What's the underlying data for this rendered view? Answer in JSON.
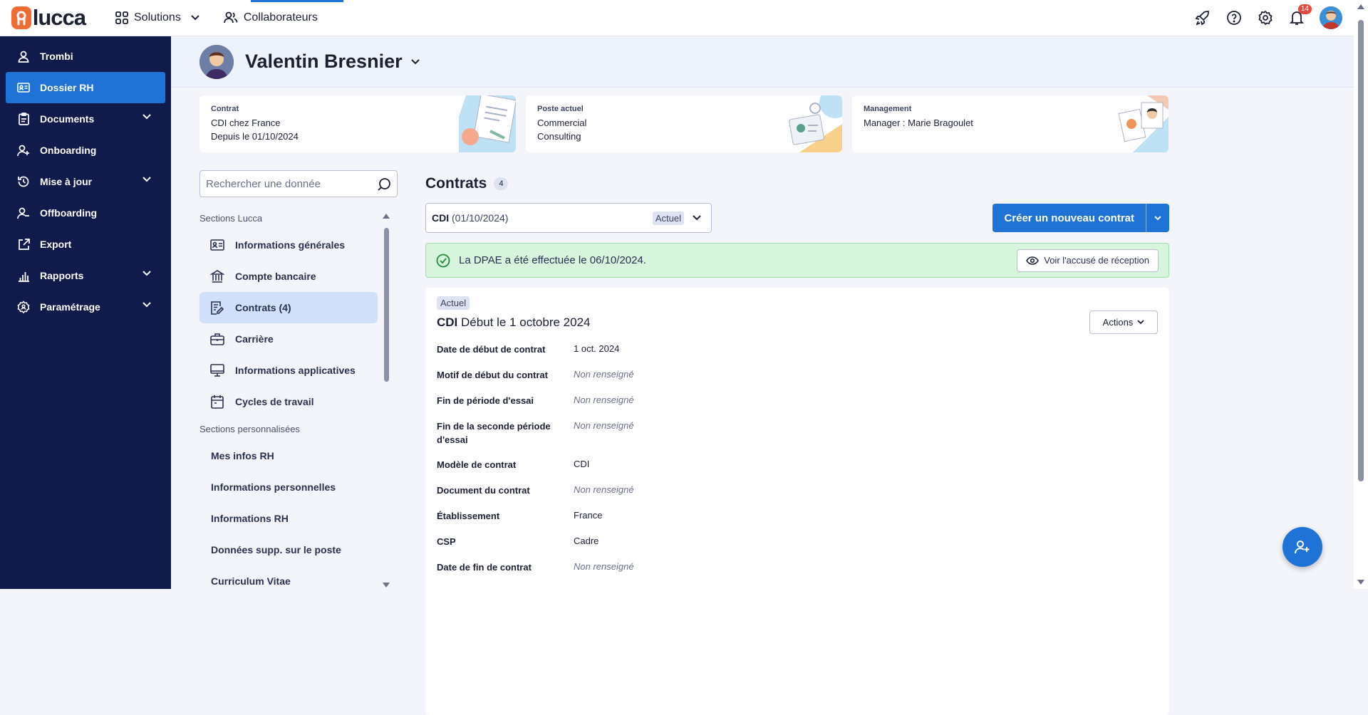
{
  "app": {
    "logo_text": "lucca"
  },
  "topnav": {
    "solutions": "Solutions",
    "collaborateurs": "Collaborateurs"
  },
  "topright": {
    "notification_count": "14"
  },
  "sidebar": {
    "items": [
      {
        "label": "Trombi"
      },
      {
        "label": "Dossier RH",
        "active": true
      },
      {
        "label": "Documents"
      },
      {
        "label": "Onboarding"
      },
      {
        "label": "Mise à jour"
      },
      {
        "label": "Offboarding"
      },
      {
        "label": "Export"
      },
      {
        "label": "Rapports"
      },
      {
        "label": "Paramétrage"
      }
    ]
  },
  "profile": {
    "name": "Valentin Bresnier"
  },
  "cards": {
    "contrat": {
      "label": "Contrat",
      "line1": "CDI chez France",
      "line2": "Depuis le 01/10/2024"
    },
    "poste": {
      "label": "Poste actuel",
      "line1": "Commercial",
      "line2": "Consulting"
    },
    "management": {
      "label": "Management",
      "line1": "Manager : Marie Bragoulet"
    }
  },
  "search": {
    "placeholder": "Rechercher une donnée"
  },
  "sections": {
    "lucca_title": "Sections Lucca",
    "lucca": [
      "Informations générales",
      "Compte bancaire",
      "Contrats (4)",
      "Carrière",
      "Informations applicatives",
      "Cycles de travail"
    ],
    "custom_title": "Sections personnalisées",
    "custom": [
      "Mes infos RH",
      "Informations personnelles",
      "Informations RH",
      "Données supp. sur le poste",
      "Curriculum Vitae"
    ]
  },
  "main": {
    "title": "Contrats",
    "count": "4",
    "select": {
      "type": "CDI",
      "date": "(01/10/2024)",
      "badge": "Actuel"
    },
    "create_button": "Créer un nouveau contrat",
    "alert": {
      "text": "La DPAE a été effectuée le 06/10/2024.",
      "button": "Voir l'accusé de réception"
    },
    "contract": {
      "badge": "Actuel",
      "type": "CDI",
      "title_rest": "Début le 1 octobre 2024",
      "actions": "Actions",
      "fields": [
        {
          "key": "Date de début de contrat",
          "value": "1 oct. 2024"
        },
        {
          "key": "Motif de début du contrat",
          "value": "Non renseigné",
          "empty": true
        },
        {
          "key": "Fin de période d'essai",
          "value": "Non renseigné",
          "empty": true
        },
        {
          "key": "Fin de la seconde période d'essai",
          "value": "Non renseigné",
          "empty": true
        },
        {
          "key": "Modèle de contrat",
          "value": "CDI"
        },
        {
          "key": "Document du contrat",
          "value": "Non renseigné",
          "empty": true
        },
        {
          "key": "Établissement",
          "value": "France"
        },
        {
          "key": "CSP",
          "value": "Cadre"
        },
        {
          "key": "Date de fin de contrat",
          "value": "Non renseigné",
          "empty": true
        }
      ]
    }
  },
  "colors": {
    "brand": "#f06c35",
    "primary": "#1f72d6",
    "sidebar": "#101a4b",
    "success_bg": "#d6f5dc"
  }
}
